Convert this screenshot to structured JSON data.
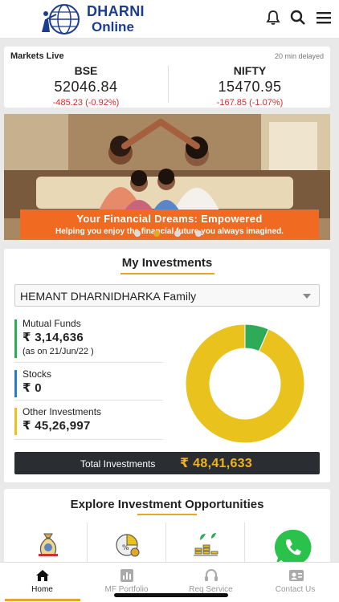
{
  "header": {
    "brand_line1": "DHARNI",
    "brand_line2": "Online",
    "icons": [
      "bell-icon",
      "search-icon",
      "menu-icon"
    ],
    "brand_color": "#1c3d8f"
  },
  "markets": {
    "title": "Markets Live",
    "delay": "20 min delayed",
    "indices": [
      {
        "name": "BSE",
        "value": "52046.84",
        "change": "-485.23",
        "percent": "(-0.92%)"
      },
      {
        "name": "NIFTY",
        "value": "15470.95",
        "change": "-167.85",
        "percent": "(-1.07%)"
      }
    ],
    "negative_color": "#d0302c"
  },
  "banner": {
    "title": "Your Financial Dreams: Empowered",
    "subtitle": "Helping you enjoy the financial future you always imagined.",
    "slide_count": 4,
    "active_slide": 1,
    "caption_color": "#f06a21"
  },
  "investments": {
    "title": "My Investments",
    "selected_family": "HEMANT DHARNIDHARKA Family",
    "items": [
      {
        "label": "Mutual Funds",
        "amount": "₹ 3,14,636",
        "note": "(as on 21/Jun/22 )",
        "color": "#2eaa58"
      },
      {
        "label": "Stocks",
        "amount": "₹ 0",
        "color": "#2d7bc4"
      },
      {
        "label": "Other Investments",
        "amount": "₹ 45,26,997",
        "color": "#e9c21e"
      }
    ],
    "chart_data": {
      "type": "pie",
      "categories": [
        "Mutual Funds",
        "Stocks",
        "Other Investments"
      ],
      "values": [
        314636,
        0,
        4526997
      ],
      "colors": [
        "#2eaa58",
        "#2d7bc4",
        "#e9c21e"
      ]
    },
    "total_label": "Total Investments",
    "total_value": "₹ 48,41,633",
    "accent": "#e5a728"
  },
  "explore": {
    "title": "Explore Investment Opportunities",
    "tiles": [
      "money-bag-icon",
      "percent-chart-icon",
      "growth-coins-icon",
      "globe-icon"
    ]
  },
  "bottom_nav": {
    "items": [
      {
        "label": "Home",
        "icon": "home-icon",
        "active": true
      },
      {
        "label": "MF Portfolio",
        "icon": "portfolio-icon",
        "active": false
      },
      {
        "label": "Req Service",
        "icon": "headset-icon",
        "active": false
      },
      {
        "label": "Contact Us",
        "icon": "contact-card-icon",
        "active": false
      }
    ]
  }
}
